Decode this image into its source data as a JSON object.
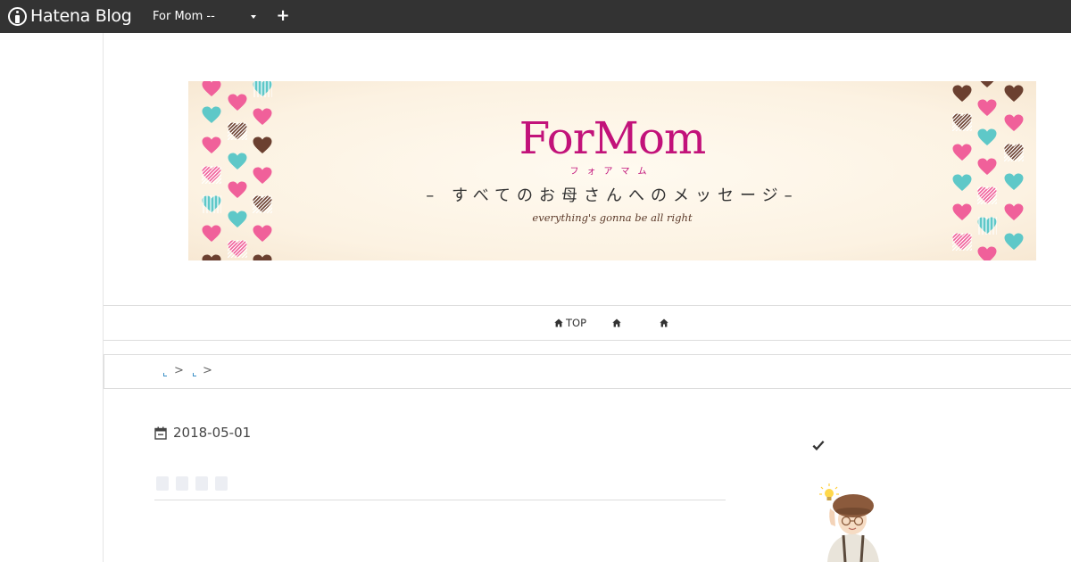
{
  "topbar": {
    "logo_text": "Hatena Blog",
    "logo_icon": "hatena-blog-icon",
    "blog_selector_value": "For Mom --",
    "add_icon": "plus-icon"
  },
  "banner": {
    "title": "ForMom",
    "kana": "フォアマム",
    "subtitle": "– すべてのお母さんへのメッセージ–",
    "tagline": "everything's gonna be all right",
    "colors": {
      "pink": "#f0609a",
      "teal": "#5ec8c8",
      "brown": "#6b4030",
      "title": "#c2127a"
    }
  },
  "nav": {
    "items": [
      {
        "label": "TOP",
        "icon": "home-icon"
      },
      {
        "label": "",
        "icon": "home-icon"
      },
      {
        "label": "",
        "icon": "home-icon"
      }
    ]
  },
  "breadcrumb": {
    "separators": [
      ">",
      ">"
    ]
  },
  "article": {
    "date": "2018-05-01",
    "date_icon": "calendar-icon"
  },
  "sidebar": {
    "check_icon": "check-icon",
    "profile_image": "profile-child-photo"
  }
}
